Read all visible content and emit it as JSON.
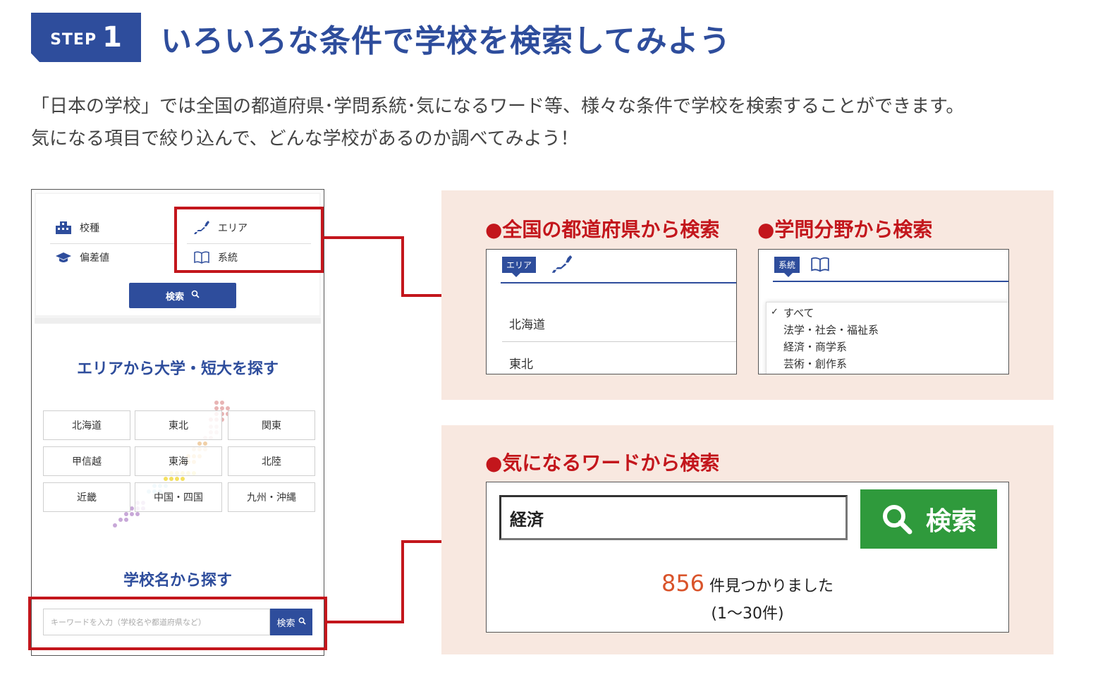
{
  "header": {
    "step_word": "STEP",
    "step_num": "1",
    "title": "いろいろな条件で学校を検索してみよう"
  },
  "intro": {
    "line1": "「日本の学校」では全国の都道府県･学問系統･気になるワード等、様々な条件で学校を検索することができます。",
    "line2": "気になる項目で絞り込んで、どんな学校があるのか調べてみよう！"
  },
  "phone": {
    "categories": [
      {
        "label": "校種",
        "icon": "building-icon"
      },
      {
        "label": "エリア",
        "icon": "japan-map-icon"
      },
      {
        "label": "偏差値",
        "icon": "graduation-cap-icon"
      },
      {
        "label": "系統",
        "icon": "book-icon"
      }
    ],
    "search_button": "検索",
    "area_heading": "エリアから大学・短大を探す",
    "regions": [
      "北海道",
      "東北",
      "関東",
      "甲信越",
      "東海",
      "北陸",
      "近畿",
      "中国・四国",
      "九州・沖縄"
    ],
    "name_heading": "学校名から探す",
    "keyword_placeholder": "キーワードを入力（学校名や都道府県など）",
    "keyword_button": "検索"
  },
  "prefecture_search": {
    "title": "●全国の都道府県から検索",
    "tag": "エリア",
    "items": [
      "北海道",
      "東北"
    ]
  },
  "field_search": {
    "title": "●学問分野から検索",
    "tag": "系統",
    "options": [
      "すべて",
      "法学・社会・福祉系",
      "経済・商学系",
      "芸術・創作系"
    ],
    "selected_mark": "✓"
  },
  "word_search": {
    "title": "●気になるワードから検索",
    "input_value": "経済",
    "button": "検索",
    "result_count": "856",
    "result_text": "件見つかりました",
    "result_range": "(1〜30件)"
  },
  "colors": {
    "brand_blue": "#2e4d9c",
    "accent_red": "#c3161c",
    "panel_bg": "#f8e8e0",
    "search_green": "#2f9a3c",
    "count_orange": "#d9532a"
  }
}
